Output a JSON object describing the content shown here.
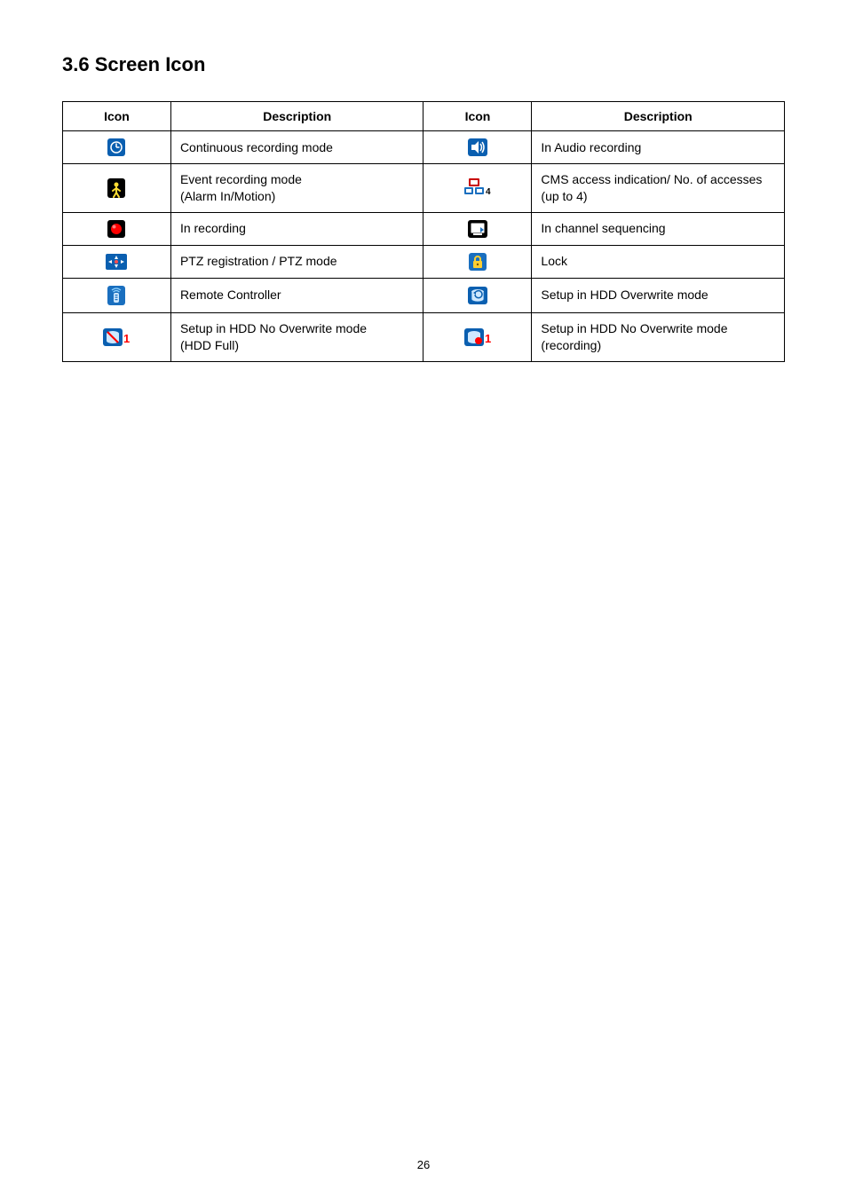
{
  "heading": "3.6  Screen Icon",
  "table": {
    "headers": {
      "icon": "Icon",
      "description": "Description"
    },
    "rows": [
      {
        "left": {
          "iconName": "continuous-rec-icon",
          "desc": "Continuous recording mode"
        },
        "right": {
          "iconName": "audio-rec-icon",
          "desc": "In Audio recording"
        }
      },
      {
        "left": {
          "iconName": "event-rec-icon",
          "desc": "Event recording mode\n(Alarm In/Motion)"
        },
        "right": {
          "iconName": "cms-access-icon",
          "desc": "CMS access indication/ No. of accesses\n(up to 4)"
        }
      },
      {
        "left": {
          "iconName": "in-recording-icon",
          "desc": "In recording"
        },
        "right": {
          "iconName": "channel-seq-icon",
          "desc": "In channel sequencing"
        }
      },
      {
        "left": {
          "iconName": "ptz-mode-icon",
          "desc": "PTZ registration / PTZ mode"
        },
        "right": {
          "iconName": "lock-icon",
          "desc": "Lock"
        }
      },
      {
        "left": {
          "iconName": "remote-controller-icon",
          "desc": "Remote Controller"
        },
        "right": {
          "iconName": "hdd-overwrite-icon",
          "desc": "Setup in HDD Overwrite mode"
        }
      },
      {
        "left": {
          "iconName": "hdd-no-overwrite-full-icon",
          "desc": "Setup in HDD No Overwrite mode\n(HDD Full)"
        },
        "right": {
          "iconName": "hdd-no-overwrite-rec-icon",
          "desc": "Setup in HDD No Overwrite mode\n(recording)"
        }
      }
    ]
  },
  "page_number": "26"
}
